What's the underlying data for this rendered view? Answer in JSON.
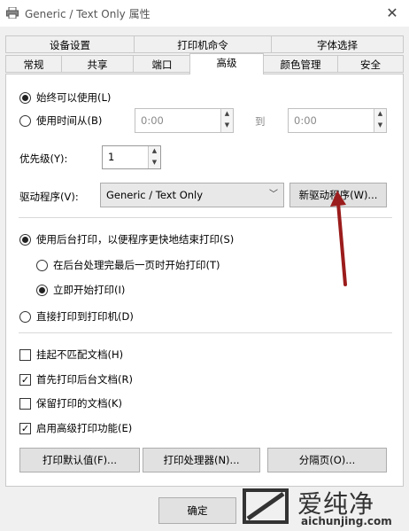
{
  "window": {
    "title": "Generic / Text Only 属性",
    "close_icon": "close-icon"
  },
  "tabs_row1": [
    "设备设置",
    "打印机命令",
    "字体选择"
  ],
  "tabs_row2": [
    "常规",
    "共享",
    "端口",
    "高级",
    "颜色管理",
    "安全"
  ],
  "active_tab": "高级",
  "availability": {
    "always_label": "始终可以使用(L)",
    "time_label": "使用时间从(B)",
    "from_value": "0:00",
    "to_label": "到",
    "to_value": "0:00"
  },
  "priority": {
    "label": "优先级(Y):",
    "value": "1"
  },
  "driver": {
    "label": "驱动程序(V):",
    "selected": "Generic / Text Only",
    "new_button": "新驱动程序(W)..."
  },
  "spool": {
    "spool_label": "使用后台打印，以便程序更快地结束打印(S)",
    "after_last_label": "在后台处理完最后一页时开始打印(T)",
    "immediately_label": "立即开始打印(I)",
    "direct_label": "直接打印到打印机(D)"
  },
  "options": [
    {
      "label": "挂起不匹配文档(H)",
      "checked": false
    },
    {
      "label": "首先打印后台文档(R)",
      "checked": true
    },
    {
      "label": "保留打印的文档(K)",
      "checked": false
    },
    {
      "label": "启用高级打印功能(E)",
      "checked": true
    }
  ],
  "buttons": {
    "defaults": "打印默认值(F)...",
    "processor": "打印处理器(N)...",
    "separator": "分隔页(O)...",
    "ok": "确定"
  },
  "watermark": {
    "brand": "爱纯净",
    "url": "aichunjing.com"
  },
  "annotation_color": "#9b1c1c"
}
